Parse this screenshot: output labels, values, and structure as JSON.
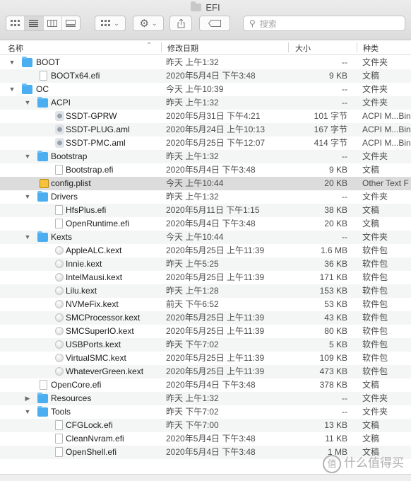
{
  "window": {
    "title": "EFI"
  },
  "toolbar": {
    "search_placeholder": "搜索",
    "icons": [
      "icon-view-button",
      "list-view-button",
      "column-view-button",
      "gallery-view-button",
      "group-button",
      "action-gear-button",
      "share-button",
      "tag-button"
    ]
  },
  "columns": {
    "name": "名称",
    "date": "修改日期",
    "size": "大小",
    "kind": "种类"
  },
  "rows": [
    {
      "name": "BOOT",
      "date": "昨天 上午1:32",
      "size": "--",
      "kind": "文件夹",
      "depth": 0,
      "icon": "folder",
      "disclosure": "open"
    },
    {
      "name": "BOOTx64.efi",
      "date": "2020年5月4日 下午3:48",
      "size": "9 KB",
      "kind": "文稿",
      "depth": 1,
      "icon": "file",
      "disclosure": "none"
    },
    {
      "name": "OC",
      "date": "今天 上午10:39",
      "size": "--",
      "kind": "文件夹",
      "depth": 0,
      "icon": "folder",
      "disclosure": "open"
    },
    {
      "name": "ACPI",
      "date": "昨天 上午1:32",
      "size": "--",
      "kind": "文件夹",
      "depth": 1,
      "icon": "folder",
      "disclosure": "open"
    },
    {
      "name": "SSDT-GPRW",
      "date": "2020年5月31日 下午4:21",
      "size": "101 字节",
      "kind": "ACPI M...Binary",
      "depth": 2,
      "icon": "aml",
      "disclosure": "none"
    },
    {
      "name": "SSDT-PLUG.aml",
      "date": "2020年5月24日 上午10:13",
      "size": "167 字节",
      "kind": "ACPI M...Binary",
      "depth": 2,
      "icon": "aml",
      "disclosure": "none"
    },
    {
      "name": "SSDT-PMC.aml",
      "date": "2020年5月25日 下午12:07",
      "size": "414 字节",
      "kind": "ACPI M...Binary",
      "depth": 2,
      "icon": "aml",
      "disclosure": "none"
    },
    {
      "name": "Bootstrap",
      "date": "昨天 上午1:32",
      "size": "--",
      "kind": "文件夹",
      "depth": 1,
      "icon": "folder",
      "disclosure": "open"
    },
    {
      "name": "Bootstrap.efi",
      "date": "2020年5月4日 下午3:48",
      "size": "9 KB",
      "kind": "文稿",
      "depth": 2,
      "icon": "file",
      "disclosure": "none"
    },
    {
      "name": "config.plist",
      "date": "今天 上午10:44",
      "size": "20 KB",
      "kind": "Other Text F",
      "depth": 1,
      "icon": "plist",
      "disclosure": "none",
      "selected": true
    },
    {
      "name": "Drivers",
      "date": "昨天 上午1:32",
      "size": "--",
      "kind": "文件夹",
      "depth": 1,
      "icon": "folder",
      "disclosure": "open"
    },
    {
      "name": "HfsPlus.efi",
      "date": "2020年5月11日 下午1:15",
      "size": "38 KB",
      "kind": "文稿",
      "depth": 2,
      "icon": "file",
      "disclosure": "none"
    },
    {
      "name": "OpenRuntime.efi",
      "date": "2020年5月4日 下午3:48",
      "size": "20 KB",
      "kind": "文稿",
      "depth": 2,
      "icon": "file",
      "disclosure": "none"
    },
    {
      "name": "Kexts",
      "date": "今天 上午10:44",
      "size": "--",
      "kind": "文件夹",
      "depth": 1,
      "icon": "folder",
      "disclosure": "open"
    },
    {
      "name": "AppleALC.kext",
      "date": "2020年5月25日 上午11:39",
      "size": "1.6 MB",
      "kind": "软件包",
      "depth": 2,
      "icon": "kext",
      "disclosure": "none"
    },
    {
      "name": "Innie.kext",
      "date": "昨天 上午5:25",
      "size": "36 KB",
      "kind": "软件包",
      "depth": 2,
      "icon": "kext",
      "disclosure": "none"
    },
    {
      "name": "IntelMausi.kext",
      "date": "2020年5月25日 上午11:39",
      "size": "171 KB",
      "kind": "软件包",
      "depth": 2,
      "icon": "kext",
      "disclosure": "none"
    },
    {
      "name": "Lilu.kext",
      "date": "昨天 上午1:28",
      "size": "153 KB",
      "kind": "软件包",
      "depth": 2,
      "icon": "kext",
      "disclosure": "none"
    },
    {
      "name": "NVMeFix.kext",
      "date": "前天 下午6:52",
      "size": "53 KB",
      "kind": "软件包",
      "depth": 2,
      "icon": "kext",
      "disclosure": "none"
    },
    {
      "name": "SMCProcessor.kext",
      "date": "2020年5月25日 上午11:39",
      "size": "43 KB",
      "kind": "软件包",
      "depth": 2,
      "icon": "kext",
      "disclosure": "none"
    },
    {
      "name": "SMCSuperIO.kext",
      "date": "2020年5月25日 上午11:39",
      "size": "80 KB",
      "kind": "软件包",
      "depth": 2,
      "icon": "kext",
      "disclosure": "none"
    },
    {
      "name": "USBPorts.kext",
      "date": "昨天 下午7:02",
      "size": "5 KB",
      "kind": "软件包",
      "depth": 2,
      "icon": "kext",
      "disclosure": "none"
    },
    {
      "name": "VirtualSMC.kext",
      "date": "2020年5月25日 上午11:39",
      "size": "109 KB",
      "kind": "软件包",
      "depth": 2,
      "icon": "kext",
      "disclosure": "none"
    },
    {
      "name": "WhateverGreen.kext",
      "date": "2020年5月25日 上午11:39",
      "size": "473 KB",
      "kind": "软件包",
      "depth": 2,
      "icon": "kext",
      "disclosure": "none"
    },
    {
      "name": "OpenCore.efi",
      "date": "2020年5月4日 下午3:48",
      "size": "378 KB",
      "kind": "文稿",
      "depth": 1,
      "icon": "file",
      "disclosure": "none"
    },
    {
      "name": "Resources",
      "date": "昨天 上午1:32",
      "size": "--",
      "kind": "文件夹",
      "depth": 1,
      "icon": "folder",
      "disclosure": "closed"
    },
    {
      "name": "Tools",
      "date": "昨天 下午7:02",
      "size": "--",
      "kind": "文件夹",
      "depth": 1,
      "icon": "folder",
      "disclosure": "open"
    },
    {
      "name": "CFGLock.efi",
      "date": "昨天 下午7:00",
      "size": "13 KB",
      "kind": "文稿",
      "depth": 2,
      "icon": "file",
      "disclosure": "none"
    },
    {
      "name": "CleanNvram.efi",
      "date": "2020年5月4日 下午3:48",
      "size": "11 KB",
      "kind": "文稿",
      "depth": 2,
      "icon": "file",
      "disclosure": "none"
    },
    {
      "name": "OpenShell.efi",
      "date": "2020年5月4日 下午3:48",
      "size": "1 MB",
      "kind": "文稿",
      "depth": 2,
      "icon": "file",
      "disclosure": "none"
    }
  ],
  "watermark": {
    "logo": "值",
    "text": "什么值得买"
  }
}
